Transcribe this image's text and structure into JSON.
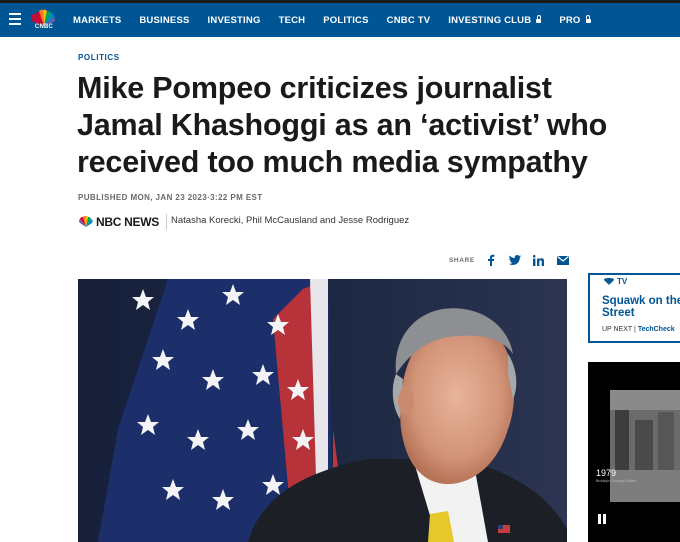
{
  "header": {
    "logo_text": "CNBC",
    "nav": [
      {
        "label": "MARKETS",
        "locked": false
      },
      {
        "label": "BUSINESS",
        "locked": false
      },
      {
        "label": "INVESTING",
        "locked": false
      },
      {
        "label": "TECH",
        "locked": false
      },
      {
        "label": "POLITICS",
        "locked": false
      },
      {
        "label": "CNBC TV",
        "locked": false
      },
      {
        "label": "INVESTING CLUB",
        "locked": true
      },
      {
        "label": "PRO",
        "locked": true
      }
    ]
  },
  "article": {
    "kicker": "POLITICS",
    "headline_lines": [
      "Mike Pompeo criticizes journalist",
      "Jamal Khashoggi as an ‘activist’ who",
      "received too much media sympathy"
    ],
    "published": "PUBLISHED MON, JAN 23 2023·3:22 PM EST",
    "source": "NBC NEWS",
    "byline": "Natasha Korecki, Phil McCausland and Jesse Rodriguez",
    "share_label": "SHARE",
    "share_icons": [
      "facebook-icon",
      "twitter-icon",
      "linkedin-icon",
      "email-icon"
    ]
  },
  "sidebar": {
    "tv_label": "TV",
    "show_title": "Squawk on the Street",
    "up_next_label": "UP NEXT |",
    "up_next_show": "TechCheck",
    "video_year": "1979",
    "video_caption": "Brooklyn Crossing Bottom"
  },
  "colors": {
    "brand_blue": "#005594",
    "topbar_border": "#1a1a1a"
  }
}
